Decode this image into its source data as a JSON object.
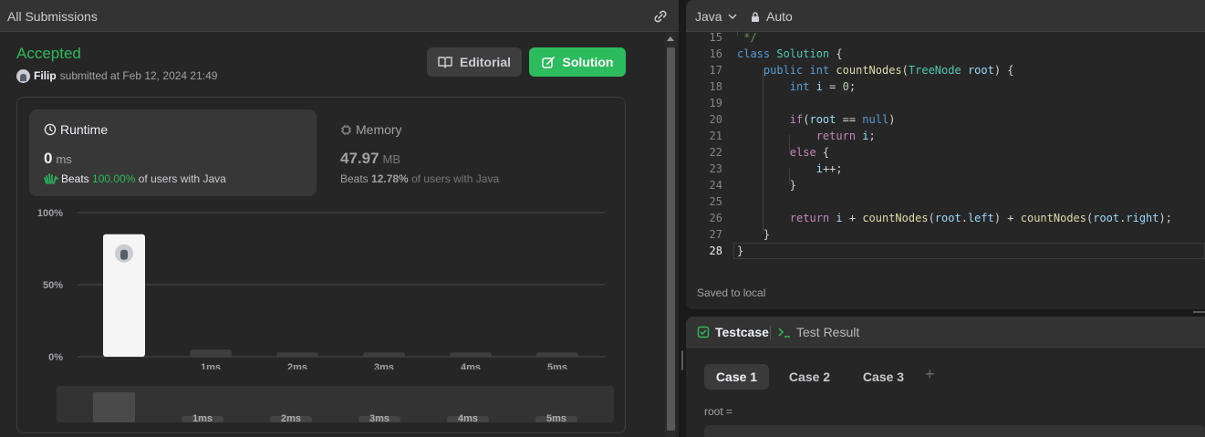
{
  "left_panel": {
    "title": "All Submissions",
    "status": "Accepted",
    "submitter_name": "Filip",
    "submitted_text": "submitted at Feb 12, 2024 21:49",
    "editorial_label": "Editorial",
    "solution_label": "Solution",
    "runtime": {
      "label": "Runtime",
      "value": "0",
      "unit": "ms",
      "beats_prefix": "Beats",
      "beats_percent": "100.00%",
      "beats_suffix": "of users with Java"
    },
    "memory": {
      "label": "Memory",
      "value": "47.97",
      "unit": "MB",
      "beats_prefix": "Beats",
      "beats_percent": "12.78%",
      "beats_suffix": "of users with Java"
    },
    "mini_labels": [
      "1ms",
      "2ms",
      "3ms",
      "4ms",
      "5ms"
    ]
  },
  "chart_data": {
    "type": "bar",
    "categories": [
      "",
      "1ms",
      "2ms",
      "3ms",
      "4ms",
      "5ms"
    ],
    "values": [
      85,
      5,
      3,
      3,
      3,
      3
    ],
    "ylim": [
      0,
      100
    ],
    "yticks": [
      "0%",
      "50%",
      "100%"
    ],
    "grid": true,
    "highlight_index": 0
  },
  "editor": {
    "language": "Java",
    "mode": "Auto",
    "saved_text": "Saved to local",
    "lines": [
      {
        "n": "15",
        "html": " <span class=\"c\">*/</span>"
      },
      {
        "n": "16",
        "html": "<span class=\"k2\">class</span> <span class=\"t\">Solution</span> {"
      },
      {
        "n": "17",
        "html": "    <span class=\"k2\">public</span> <span class=\"k2\">int</span> <span class=\"f\">countNodes</span>(<span class=\"t\">TreeNode</span> <span class=\"v\">root</span>) {"
      },
      {
        "n": "18",
        "html": "        <span class=\"k2\">int</span> <span class=\"v\">i</span> = <span class=\"n\">0</span>;"
      },
      {
        "n": "19",
        "html": ""
      },
      {
        "n": "20",
        "html": "        <span class=\"k\">if</span>(<span class=\"v\">root</span> == <span class=\"k2\">null</span>)"
      },
      {
        "n": "21",
        "html": "            <span class=\"k\">return</span> <span class=\"v\">i</span>;"
      },
      {
        "n": "22",
        "html": "        <span class=\"k\">else</span> {"
      },
      {
        "n": "23",
        "html": "            <span class=\"v\">i</span>++;"
      },
      {
        "n": "24",
        "html": "        }"
      },
      {
        "n": "25",
        "html": ""
      },
      {
        "n": "26",
        "html": "        <span class=\"k\">return</span> <span class=\"v\">i</span> + <span class=\"f\">countNodes</span>(<span class=\"v\">root</span>.<span class=\"v\">left</span>) + <span class=\"f\">countNodes</span>(<span class=\"v\">root</span>.<span class=\"v\">right</span>);"
      },
      {
        "n": "27",
        "html": "    }"
      },
      {
        "n": "28",
        "html": "}"
      }
    ]
  },
  "testcase": {
    "tab_testcase": "Testcase",
    "tab_result": "Test Result",
    "cases": [
      "Case 1",
      "Case 2",
      "Case 3"
    ],
    "plus": "+",
    "root_label": "root ="
  },
  "colors": {
    "accent_green": "#2cbb5d",
    "bar_highlight": "#f5f5f5",
    "bar_default": "#3e3e3e"
  },
  "icons": [
    "link-icon",
    "book-icon",
    "edit-icon",
    "clock-icon",
    "chip-icon",
    "lock-icon",
    "chevron-down-icon",
    "check-square-icon",
    "terminal-icon",
    "plus-icon",
    "clap-icon"
  ]
}
